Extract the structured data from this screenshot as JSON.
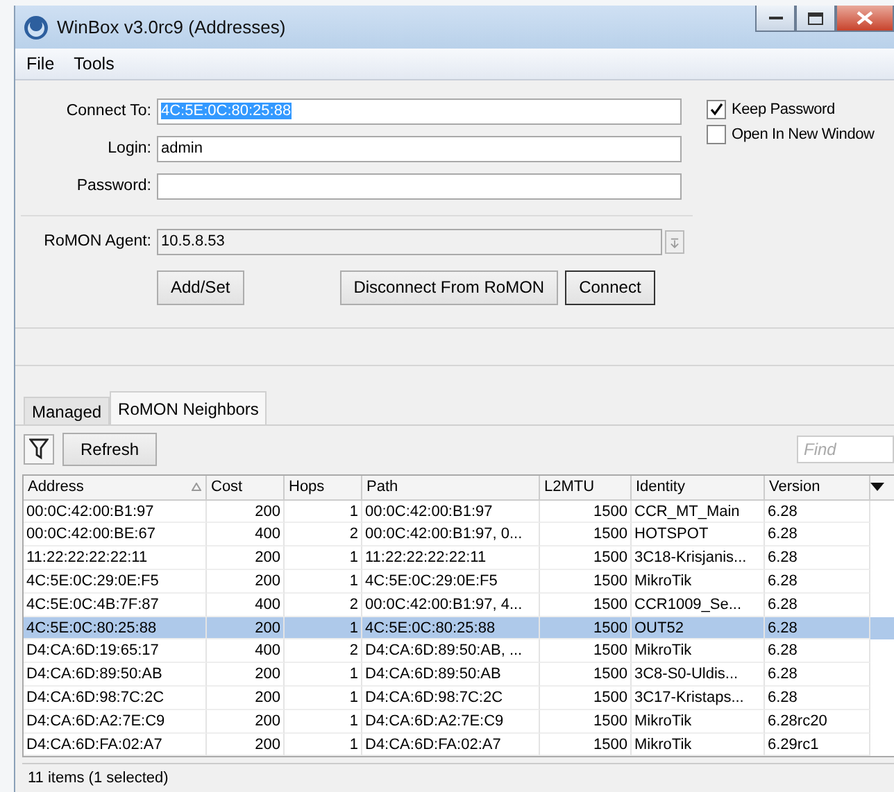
{
  "window": {
    "title": "WinBox v3.0rc9 (Addresses)"
  },
  "menu": [
    "File",
    "Tools"
  ],
  "form": {
    "connect_to": {
      "label": "Connect To:",
      "value": "4C:5E:0C:80:25:88",
      "value_selected": true
    },
    "login": {
      "label": "Login:",
      "value": "admin"
    },
    "password": {
      "label": "Password:"
    },
    "keep_password": {
      "label": "Keep Password",
      "checked": true
    },
    "open_in_new_window": {
      "label": "Open In New Window",
      "checked": false
    },
    "romon_agent": {
      "label": "RoMON Agent:",
      "value": "10.5.8.53"
    },
    "buttons": [
      {
        "label": "Add/Set",
        "default": false
      },
      {
        "label": "Disconnect From RoMON",
        "default": false
      },
      {
        "label": "Connect",
        "default": true
      }
    ]
  },
  "tabs": [
    {
      "label": "Managed",
      "selected": false
    },
    {
      "label": "RoMON Neighbors",
      "selected": true
    }
  ],
  "toolbar": {
    "refresh": "Refresh",
    "find_placeholder": "Find"
  },
  "table": {
    "columns": [
      {
        "label": "Address",
        "sorted": true
      },
      {
        "label": "Cost",
        "sorted": false
      },
      {
        "label": "Hops",
        "sorted": false
      },
      {
        "label": "Path",
        "sorted": false
      },
      {
        "label": "L2MTU",
        "sorted": false
      },
      {
        "label": "Identity",
        "sorted": false
      },
      {
        "label": "Version",
        "sorted": false
      }
    ],
    "rows": [
      {
        "cells": [
          "00:0C:42:00:B1:97",
          "200",
          "1",
          "00:0C:42:00:B1:97",
          "1500",
          "CCR_MT_Main",
          "6.28"
        ],
        "selected": false
      },
      {
        "cells": [
          "00:0C:42:00:BE:67",
          "400",
          "2",
          "00:0C:42:00:B1:97, 0...",
          "1500",
          "HOTSPOT",
          "6.28"
        ],
        "selected": false
      },
      {
        "cells": [
          "11:22:22:22:22:11",
          "200",
          "1",
          "11:22:22:22:22:11",
          "1500",
          "3C18-Krisjanis...",
          "6.28"
        ],
        "selected": false
      },
      {
        "cells": [
          "4C:5E:0C:29:0E:F5",
          "200",
          "1",
          "4C:5E:0C:29:0E:F5",
          "1500",
          "MikroTik",
          "6.28"
        ],
        "selected": false
      },
      {
        "cells": [
          "4C:5E:0C:4B:7F:87",
          "400",
          "2",
          "00:0C:42:00:B1:97, 4...",
          "1500",
          "CCR1009_Se...",
          "6.28"
        ],
        "selected": false
      },
      {
        "cells": [
          "4C:5E:0C:80:25:88",
          "200",
          "1",
          "4C:5E:0C:80:25:88",
          "1500",
          "OUT52",
          "6.28"
        ],
        "selected": true
      },
      {
        "cells": [
          "D4:CA:6D:19:65:17",
          "400",
          "2",
          "D4:CA:6D:89:50:AB, ...",
          "1500",
          "MikroTik",
          "6.28"
        ],
        "selected": false
      },
      {
        "cells": [
          "D4:CA:6D:89:50:AB",
          "200",
          "1",
          "D4:CA:6D:89:50:AB",
          "1500",
          "3C8-S0-Uldis...",
          "6.28"
        ],
        "selected": false
      },
      {
        "cells": [
          "D4:CA:6D:98:7C:2C",
          "200",
          "1",
          "D4:CA:6D:98:7C:2C",
          "1500",
          "3C17-Kristaps...",
          "6.28"
        ],
        "selected": false
      },
      {
        "cells": [
          "D4:CA:6D:A2:7E:C9",
          "200",
          "1",
          "D4:CA:6D:A2:7E:C9",
          "1500",
          "MikroTik",
          "6.28rc20"
        ],
        "selected": false
      },
      {
        "cells": [
          "D4:CA:6D:FA:02:A7",
          "200",
          "1",
          "D4:CA:6D:FA:02:A7",
          "1500",
          "MikroTik",
          "6.29rc1"
        ],
        "selected": false
      }
    ]
  },
  "status_bar": "11 items (1 selected)"
}
